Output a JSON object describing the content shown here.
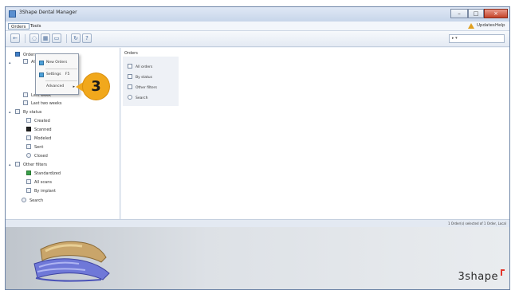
{
  "window": {
    "title": "3Shape Dental Manager",
    "controls": [
      "–",
      "□",
      "×"
    ]
  },
  "menubar": {
    "items": [
      "Orders",
      "Tools"
    ],
    "right_items": [
      "Updates",
      "Help"
    ],
    "warning_icon": "warning-icon"
  },
  "toolbar": {
    "buttons": [
      {
        "name": "back-button",
        "icon": "arrow-left-icon",
        "glyph": "←"
      },
      {
        "name": "new-order-button",
        "icon": "tooth-icon",
        "glyph": "◌"
      },
      {
        "name": "open-order-button",
        "icon": "folder-icon",
        "glyph": "▦"
      },
      {
        "name": "print-button",
        "icon": "print-icon",
        "glyph": "▭"
      },
      {
        "name": "refresh-button",
        "icon": "refresh-icon",
        "glyph": "↻"
      },
      {
        "name": "help-button",
        "icon": "help-icon",
        "glyph": "?"
      }
    ],
    "search": {
      "value": "▸ ▾"
    }
  },
  "tree": {
    "items": [
      {
        "label": "Orders",
        "icon": "orders-icon",
        "style": "blue"
      },
      {
        "label": "All Orders",
        "icon": "list-icon"
      },
      {
        "label": "Last week",
        "icon": "list-icon"
      },
      {
        "label": "Last two weeks",
        "icon": "list-icon"
      },
      {
        "label": "By status",
        "icon": "status-icon"
      },
      {
        "label": "Created",
        "icon": "created-icon"
      },
      {
        "label": "Scanned",
        "icon": "scanned-icon",
        "style": "dark"
      },
      {
        "label": "Modeled",
        "icon": "modeled-icon"
      },
      {
        "label": "Sent",
        "icon": "sent-icon"
      },
      {
        "label": "Closed",
        "icon": "closed-icon"
      },
      {
        "label": "Other filters",
        "icon": "filter-icon"
      },
      {
        "label": "Standardized",
        "icon": "standard-icon",
        "style": "green"
      },
      {
        "label": "All scans",
        "icon": "list-icon"
      },
      {
        "label": "By implant",
        "icon": "list-icon"
      },
      {
        "label": "Search",
        "icon": "search-icon"
      }
    ]
  },
  "context_menu": {
    "items": [
      {
        "label": "New Orders",
        "icon": "new-icon"
      },
      {
        "label": "Settings",
        "suffix": "F5",
        "icon": "settings-icon"
      },
      {
        "label": "Advanced",
        "icon": "advanced-icon",
        "arrow": "▸"
      }
    ]
  },
  "step_badge": {
    "number": "3",
    "color": "#f1a81c"
  },
  "content": {
    "header": "Orders",
    "items": [
      {
        "label": "All orders",
        "icon": "orders-icon"
      },
      {
        "label": "By status",
        "icon": "status-icon"
      },
      {
        "label": "Other filters",
        "icon": "filter-icon"
      },
      {
        "label": "Search",
        "icon": "search-icon"
      }
    ]
  },
  "statusbar": {
    "text": "1 Order(s) selected of 1 Order, Local"
  },
  "banner": {
    "brand": "3shape",
    "accent": "#e4362b"
  }
}
